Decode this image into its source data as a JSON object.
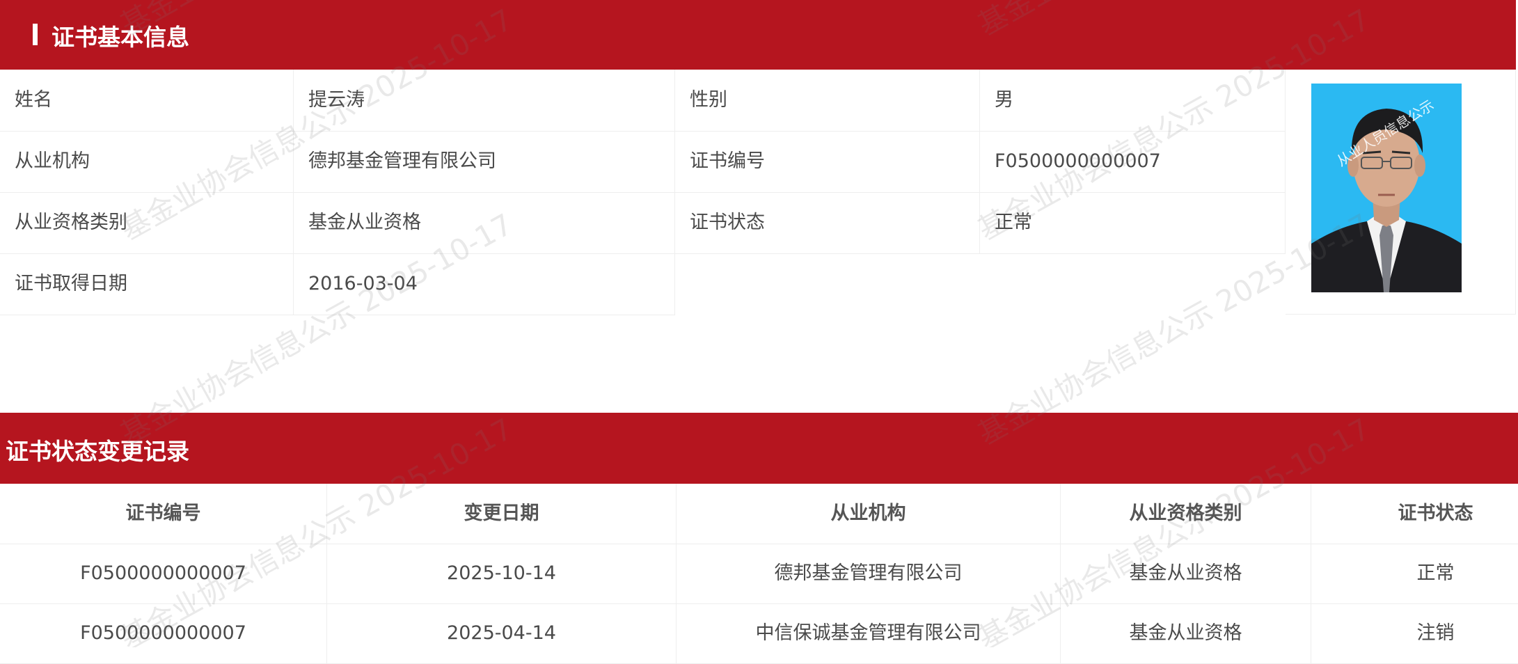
{
  "basic_info": {
    "title": "证书基本信息",
    "rows": [
      {
        "label1": "姓名",
        "value1": "提云涛",
        "label2": "性别",
        "value2": "男"
      },
      {
        "label1": "从业机构",
        "value1": "德邦基金管理有限公司",
        "label2": "证书编号",
        "value2": "F0500000000007"
      },
      {
        "label1": "从业资格类别",
        "value1": "基金从业资格",
        "label2": "证书状态",
        "value2": "正常"
      },
      {
        "label1": "证书取得日期",
        "value1": "2016-03-04"
      }
    ],
    "photo_watermark": "从业人员信息公示"
  },
  "records": {
    "title": "证书状态变更记录",
    "headers": [
      "证书编号",
      "变更日期",
      "从业机构",
      "从业资格类别",
      "证书状态"
    ],
    "rows": [
      [
        "F0500000000007",
        "2025-10-14",
        "德邦基金管理有限公司",
        "基金从业资格",
        "正常"
      ],
      [
        "F0500000000007",
        "2025-04-14",
        "中信保诚基金管理有限公司",
        "基金从业资格",
        "注销"
      ]
    ]
  },
  "watermark": "基金业协会信息公示 2025-10-17",
  "colors": {
    "accent": "#b5151f",
    "photo_bg": "#2bb9f2"
  }
}
